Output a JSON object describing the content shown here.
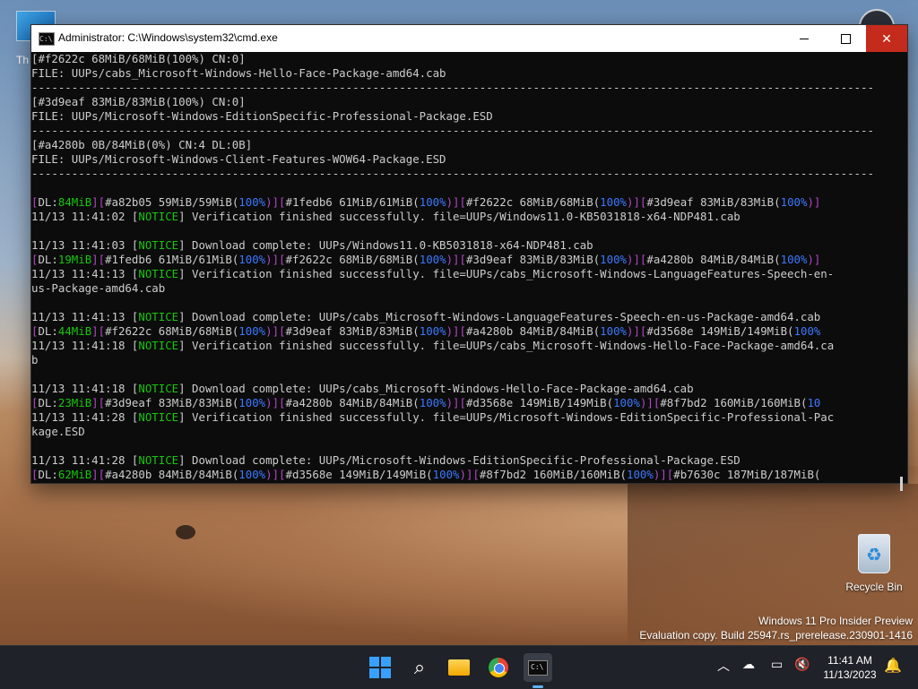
{
  "desktop": {
    "top_icon_label": "Th",
    "recycle_bin_label": "Recycle Bin",
    "watermark_line1": "Windows 11 Pro Insider Preview",
    "watermark_line2": "Evaluation copy. Build 25947.rs_prerelease.230901-1416"
  },
  "window": {
    "title": "Administrator: C:\\Windows\\system32\\cmd.exe",
    "minimize_glyph": "",
    "close_glyph": "✕"
  },
  "console": {
    "lines": [
      [
        {
          "t": "[#f2622c 68MiB/68MiB(100%) CN:0]",
          "c": "w"
        }
      ],
      [
        {
          "t": "FILE: UUPs/cabs_Microsoft-Windows-Hello-Face-Package-amd64.cab",
          "c": "w"
        }
      ],
      [
        {
          "t": "------------------------------------------------------------------------------------------------------------------------------",
          "c": "w"
        }
      ],
      [
        {
          "t": "[#3d9eaf 83MiB/83MiB(100%) CN:0]",
          "c": "w"
        }
      ],
      [
        {
          "t": "FILE: UUPs/Microsoft-Windows-EditionSpecific-Professional-Package.ESD",
          "c": "w"
        }
      ],
      [
        {
          "t": "------------------------------------------------------------------------------------------------------------------------------",
          "c": "w"
        }
      ],
      [
        {
          "t": "[#a4280b 0B/84MiB(0%) CN:4 DL:0B]",
          "c": "w"
        }
      ],
      [
        {
          "t": "FILE: UUPs/Microsoft-Windows-Client-Features-WOW64-Package.ESD",
          "c": "w"
        }
      ],
      [
        {
          "t": "------------------------------------------------------------------------------------------------------------------------------",
          "c": "w"
        }
      ],
      [
        {
          "t": "",
          "c": "w"
        }
      ],
      [
        {
          "t": "[",
          "c": "m"
        },
        {
          "t": "DL:",
          "c": "w"
        },
        {
          "t": "84MiB",
          "c": "g"
        },
        {
          "t": "][",
          "c": "m"
        },
        {
          "t": "#a82b05 59MiB/59MiB(",
          "c": "w"
        },
        {
          "t": "100%",
          "c": "b"
        },
        {
          "t": ")][",
          "c": "m"
        },
        {
          "t": "#1fedb6 61MiB/61MiB(",
          "c": "w"
        },
        {
          "t": "100%",
          "c": "b"
        },
        {
          "t": ")][",
          "c": "m"
        },
        {
          "t": "#f2622c 68MiB/68MiB(",
          "c": "w"
        },
        {
          "t": "100%",
          "c": "b"
        },
        {
          "t": ")][",
          "c": "m"
        },
        {
          "t": "#3d9eaf 83MiB/83MiB(",
          "c": "w"
        },
        {
          "t": "100%",
          "c": "b"
        },
        {
          "t": ")]",
          "c": "m"
        }
      ],
      [
        {
          "t": "11/13 11:41:02 [",
          "c": "w"
        },
        {
          "t": "NOTICE",
          "c": "g"
        },
        {
          "t": "] Verification finished successfully. file=UUPs/Windows11.0-KB5031818-x64-NDP481.cab",
          "c": "w"
        }
      ],
      [
        {
          "t": "",
          "c": "w"
        }
      ],
      [
        {
          "t": "11/13 11:41:03 [",
          "c": "w"
        },
        {
          "t": "NOTICE",
          "c": "g"
        },
        {
          "t": "] Download complete: UUPs/Windows11.0-KB5031818-x64-NDP481.cab",
          "c": "w"
        }
      ],
      [
        {
          "t": "[",
          "c": "m"
        },
        {
          "t": "DL:",
          "c": "w"
        },
        {
          "t": "19MiB",
          "c": "g"
        },
        {
          "t": "][",
          "c": "m"
        },
        {
          "t": "#1fedb6 61MiB/61MiB(",
          "c": "w"
        },
        {
          "t": "100%",
          "c": "b"
        },
        {
          "t": ")][",
          "c": "m"
        },
        {
          "t": "#f2622c 68MiB/68MiB(",
          "c": "w"
        },
        {
          "t": "100%",
          "c": "b"
        },
        {
          "t": ")][",
          "c": "m"
        },
        {
          "t": "#3d9eaf 83MiB/83MiB(",
          "c": "w"
        },
        {
          "t": "100%",
          "c": "b"
        },
        {
          "t": ")][",
          "c": "m"
        },
        {
          "t": "#a4280b 84MiB/84MiB(",
          "c": "w"
        },
        {
          "t": "100%",
          "c": "b"
        },
        {
          "t": ")]",
          "c": "m"
        }
      ],
      [
        {
          "t": "11/13 11:41:13 [",
          "c": "w"
        },
        {
          "t": "NOTICE",
          "c": "g"
        },
        {
          "t": "] Verification finished successfully. file=UUPs/cabs_Microsoft-Windows-LanguageFeatures-Speech-en-",
          "c": "w"
        }
      ],
      [
        {
          "t": "us-Package-amd64.cab",
          "c": "w"
        }
      ],
      [
        {
          "t": "",
          "c": "w"
        }
      ],
      [
        {
          "t": "11/13 11:41:13 [",
          "c": "w"
        },
        {
          "t": "NOTICE",
          "c": "g"
        },
        {
          "t": "] Download complete: UUPs/cabs_Microsoft-Windows-LanguageFeatures-Speech-en-us-Package-amd64.cab",
          "c": "w"
        }
      ],
      [
        {
          "t": "[",
          "c": "m"
        },
        {
          "t": "DL:",
          "c": "w"
        },
        {
          "t": "44MiB",
          "c": "g"
        },
        {
          "t": "][",
          "c": "m"
        },
        {
          "t": "#f2622c 68MiB/68MiB(",
          "c": "w"
        },
        {
          "t": "100%",
          "c": "b"
        },
        {
          "t": ")][",
          "c": "m"
        },
        {
          "t": "#3d9eaf 83MiB/83MiB(",
          "c": "w"
        },
        {
          "t": "100%",
          "c": "b"
        },
        {
          "t": ")][",
          "c": "m"
        },
        {
          "t": "#a4280b 84MiB/84MiB(",
          "c": "w"
        },
        {
          "t": "100%",
          "c": "b"
        },
        {
          "t": ")][",
          "c": "m"
        },
        {
          "t": "#d3568e 149MiB/149MiB(",
          "c": "w"
        },
        {
          "t": "100%",
          "c": "b"
        }
      ],
      [
        {
          "t": "11/13 11:41:18 [",
          "c": "w"
        },
        {
          "t": "NOTICE",
          "c": "g"
        },
        {
          "t": "] Verification finished successfully. file=UUPs/cabs_Microsoft-Windows-Hello-Face-Package-amd64.ca",
          "c": "w"
        }
      ],
      [
        {
          "t": "b",
          "c": "w"
        }
      ],
      [
        {
          "t": "",
          "c": "w"
        }
      ],
      [
        {
          "t": "11/13 11:41:18 [",
          "c": "w"
        },
        {
          "t": "NOTICE",
          "c": "g"
        },
        {
          "t": "] Download complete: UUPs/cabs_Microsoft-Windows-Hello-Face-Package-amd64.cab",
          "c": "w"
        }
      ],
      [
        {
          "t": "[",
          "c": "m"
        },
        {
          "t": "DL:",
          "c": "w"
        },
        {
          "t": "23MiB",
          "c": "g"
        },
        {
          "t": "][",
          "c": "m"
        },
        {
          "t": "#3d9eaf 83MiB/83MiB(",
          "c": "w"
        },
        {
          "t": "100%",
          "c": "b"
        },
        {
          "t": ")][",
          "c": "m"
        },
        {
          "t": "#a4280b 84MiB/84MiB(",
          "c": "w"
        },
        {
          "t": "100%",
          "c": "b"
        },
        {
          "t": ")][",
          "c": "m"
        },
        {
          "t": "#d3568e 149MiB/149MiB(",
          "c": "w"
        },
        {
          "t": "100%",
          "c": "b"
        },
        {
          "t": ")][",
          "c": "m"
        },
        {
          "t": "#8f7bd2 160MiB/160MiB(",
          "c": "w"
        },
        {
          "t": "10",
          "c": "b"
        }
      ],
      [
        {
          "t": "11/13 11:41:28 [",
          "c": "w"
        },
        {
          "t": "NOTICE",
          "c": "g"
        },
        {
          "t": "] Verification finished successfully. file=UUPs/Microsoft-Windows-EditionSpecific-Professional-Pac",
          "c": "w"
        }
      ],
      [
        {
          "t": "kage.ESD",
          "c": "w"
        }
      ],
      [
        {
          "t": "",
          "c": "w"
        }
      ],
      [
        {
          "t": "11/13 11:41:28 [",
          "c": "w"
        },
        {
          "t": "NOTICE",
          "c": "g"
        },
        {
          "t": "] Download complete: UUPs/Microsoft-Windows-EditionSpecific-Professional-Package.ESD",
          "c": "w"
        }
      ],
      [
        {
          "t": "[",
          "c": "m"
        },
        {
          "t": "DL:",
          "c": "w"
        },
        {
          "t": "62MiB",
          "c": "g"
        },
        {
          "t": "][",
          "c": "m"
        },
        {
          "t": "#a4280b 84MiB/84MiB(",
          "c": "w"
        },
        {
          "t": "100%",
          "c": "b"
        },
        {
          "t": ")][",
          "c": "m"
        },
        {
          "t": "#d3568e 149MiB/149MiB(",
          "c": "w"
        },
        {
          "t": "100%",
          "c": "b"
        },
        {
          "t": ")][",
          "c": "m"
        },
        {
          "t": "#8f7bd2 160MiB/160MiB(",
          "c": "w"
        },
        {
          "t": "100%",
          "c": "b"
        },
        {
          "t": ")][",
          "c": "m"
        },
        {
          "t": "#b7630c 187MiB/187MiB(",
          "c": "w"
        }
      ]
    ]
  },
  "taskbar": {
    "time": "11:41 AM",
    "date": "11/13/2023",
    "apps": [
      "start-icon",
      "search-icon",
      "file-explorer-icon",
      "chrome-icon",
      "terminal-icon"
    ]
  },
  "colors": {
    "console_bg": "#0c0c0c",
    "green": "#16c60c",
    "blue": "#3b78ff",
    "magenta": "#b148c6",
    "close_red": "#c42b1c",
    "taskbar_bg": "#1f2228"
  }
}
